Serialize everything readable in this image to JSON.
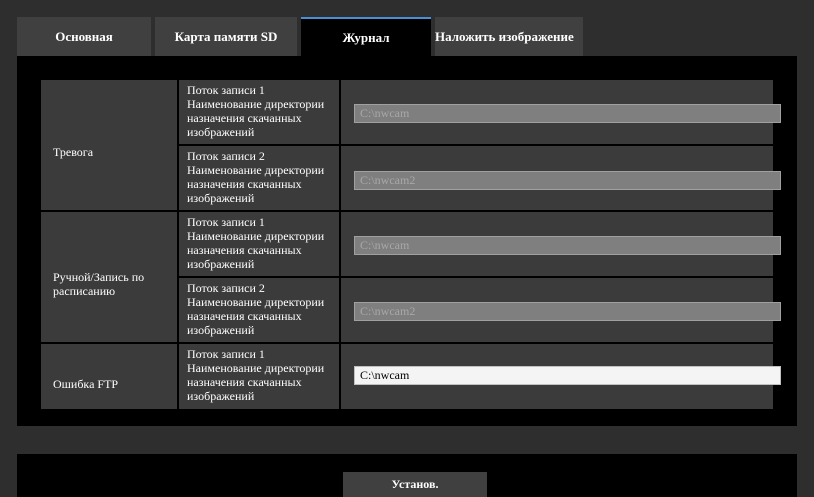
{
  "tabs": [
    {
      "label": "Основная",
      "active": false
    },
    {
      "label": "Карта памяти SD",
      "active": false
    },
    {
      "label": "Журнал",
      "active": true
    },
    {
      "label": "Наложить изображение",
      "active": false
    }
  ],
  "sections": [
    {
      "category": "Тревога",
      "rows": [
        {
          "label": "Поток записи 1 Наименование директории назначения скачанных изображений",
          "value": "C:\\nwcam",
          "disabled": true
        },
        {
          "label": "Поток записи 2 Наименование директории назначения скачанных изображений",
          "value": "C:\\nwcam2",
          "disabled": true
        }
      ]
    },
    {
      "category": "Ручной/Запись по расписанию",
      "rows": [
        {
          "label": "Поток записи 1 Наименование директории назначения скачанных изображений",
          "value": "C:\\nwcam",
          "disabled": true
        },
        {
          "label": "Поток записи 2 Наименование директории назначения скачанных изображений",
          "value": "C:\\nwcam2",
          "disabled": true
        }
      ]
    },
    {
      "category": "Ошибка FTP",
      "rows": [
        {
          "label": "Поток записи 1 Наименование директории назначения скачанных изображений",
          "value": "C:\\nwcam",
          "disabled": false
        }
      ]
    }
  ],
  "set_button": "Установ.",
  "colors": {
    "background": "#2e2e2e",
    "panel": "#000000",
    "cell": "#3b3b3b",
    "accent": "#4a90d9"
  }
}
